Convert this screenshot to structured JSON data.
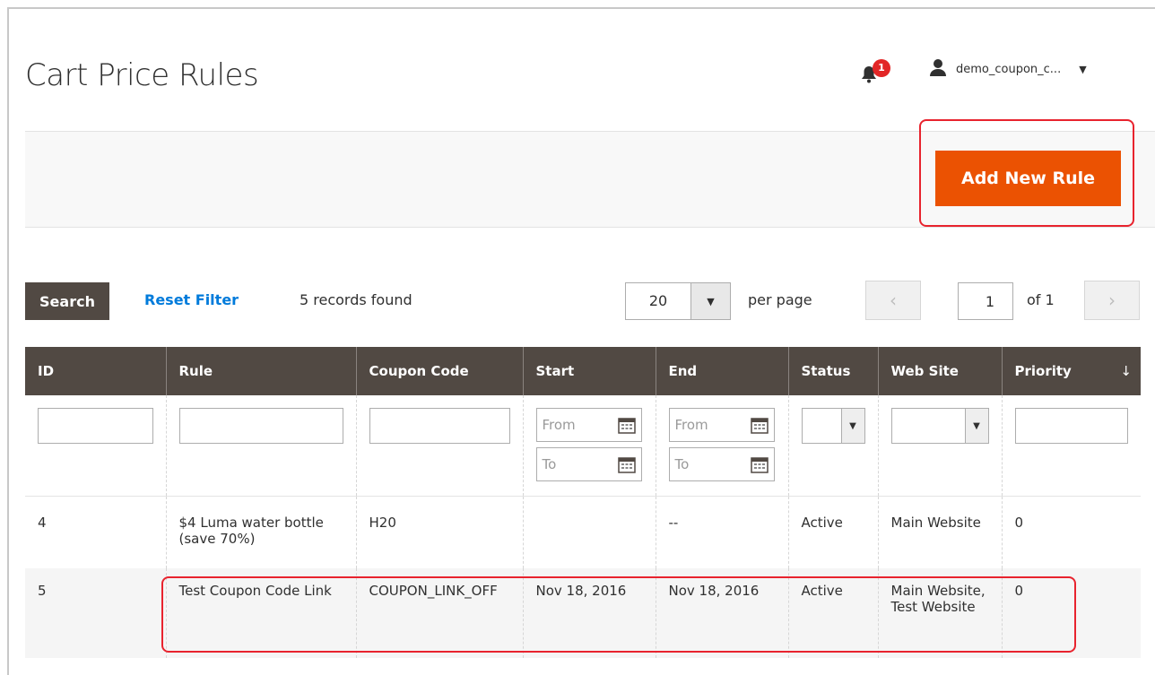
{
  "header": {
    "title": "Cart Price Rules",
    "notifications_count": "1",
    "username": "demo_coupon_c..."
  },
  "actions": {
    "add_button": "Add New Rule"
  },
  "toolbar": {
    "search_label": "Search",
    "reset_label": "Reset Filter",
    "records_found": "5 records found",
    "per_page_value": "20",
    "per_page_label": "per page",
    "current_page": "1",
    "page_of": "of 1"
  },
  "table": {
    "columns": [
      "ID",
      "Rule",
      "Coupon Code",
      "Start",
      "End",
      "Status",
      "Web Site",
      "Priority"
    ],
    "filters": {
      "from_placeholder": "From",
      "to_placeholder": "To"
    },
    "rows": [
      {
        "id": "4",
        "rule": "$4 Luma water bottle (save 70%)",
        "coupon": "H20",
        "start": "",
        "end": "--",
        "status": "Active",
        "website": "Main Website",
        "priority": "0"
      },
      {
        "id": "5",
        "rule": "Test Coupon Code Link",
        "coupon": "COUPON_LINK_OFF",
        "start": "Nov 18, 2016",
        "end": "Nov 18, 2016",
        "status": "Active",
        "website": "Main Website, Test Website",
        "priority": "0"
      }
    ]
  },
  "colors": {
    "accent": "#eb5202",
    "header_bg": "#514943",
    "highlight": "#e8232e",
    "link": "#007bdb"
  }
}
